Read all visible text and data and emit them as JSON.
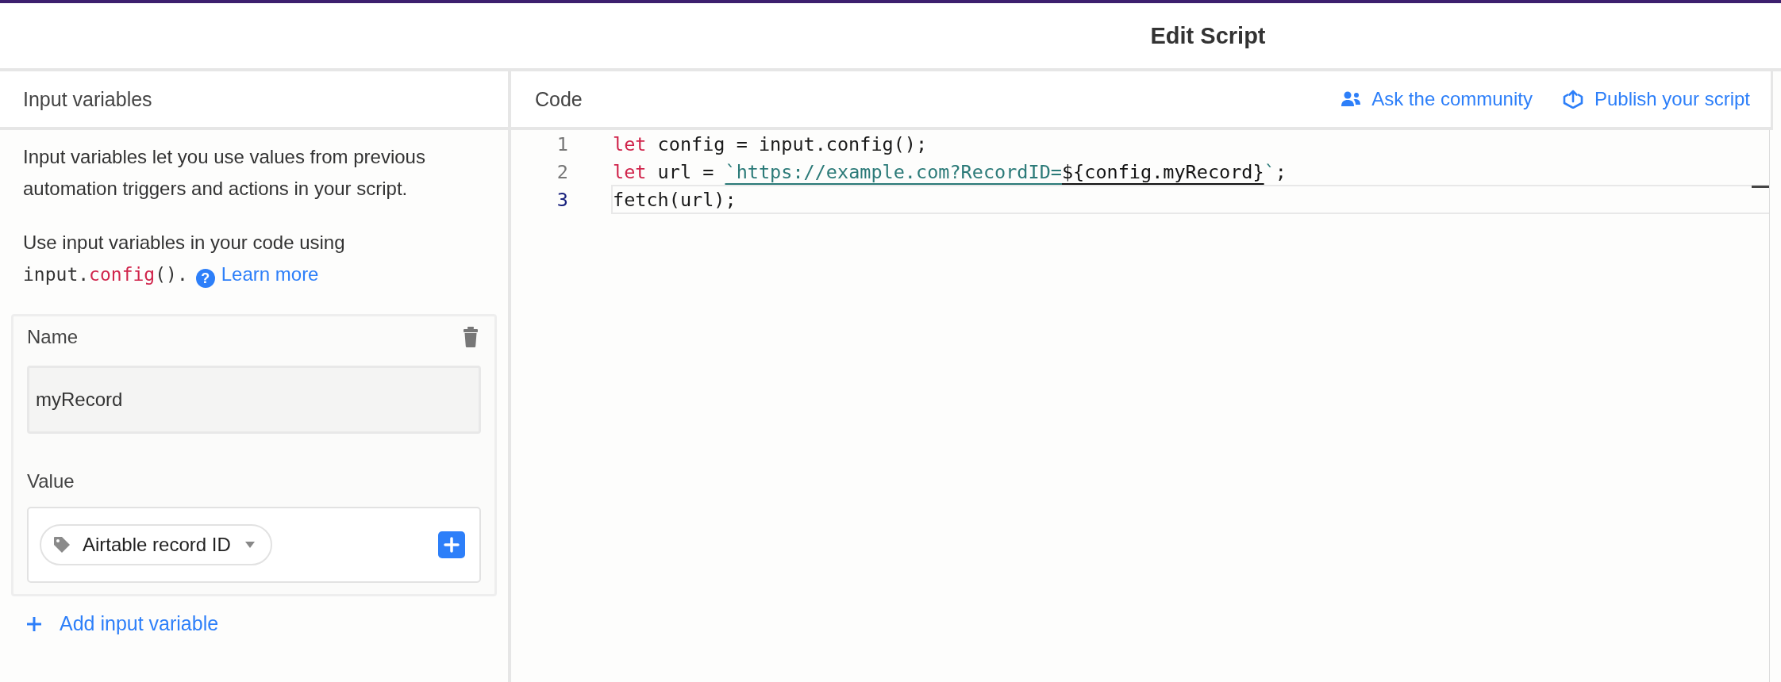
{
  "window": {
    "title": "Edit Script"
  },
  "input_panel": {
    "title": "Input variables",
    "description": "Input variables let you use values from previous automation triggers and actions in your script.",
    "usage": {
      "text": "Use input variables in your code using",
      "code": [
        {
          "text": "input.",
          "kind": "plain"
        },
        {
          "text": "config",
          "kind": "keyword"
        },
        {
          "text": "().",
          "kind": "plain"
        }
      ],
      "help": "?",
      "link": "Learn more"
    },
    "variables": [
      {
        "name_label": "Name",
        "name_value": "myRecord",
        "value_label": "Value",
        "value_pill": "Airtable record ID"
      }
    ],
    "add_button": "Add input variable"
  },
  "code_panel": {
    "title": "Code",
    "actions": [
      {
        "label": "Ask the community",
        "kind": "people"
      },
      {
        "label": "Publish your script",
        "kind": "publish"
      }
    ],
    "lines": [
      {
        "number": "1",
        "current": false,
        "tokens": [
          {
            "text": "let",
            "kind": "keyword"
          },
          {
            "text": " config = input.config();",
            "kind": "plain"
          }
        ]
      },
      {
        "number": "2",
        "current": false,
        "tokens": [
          {
            "text": "let",
            "kind": "keyword"
          },
          {
            "text": " url = ",
            "kind": "plain"
          },
          {
            "text": "`https://example.com?RecordID=",
            "kind": "string"
          },
          {
            "text": "${config.myRecord}",
            "kind": "interp"
          },
          {
            "text": "`",
            "kind": "quote"
          },
          {
            "text": ";",
            "kind": "plain"
          }
        ]
      },
      {
        "number": "3",
        "current": true,
        "tokens": [
          {
            "text": "fetch(url);",
            "kind": "plain"
          }
        ]
      }
    ]
  }
}
